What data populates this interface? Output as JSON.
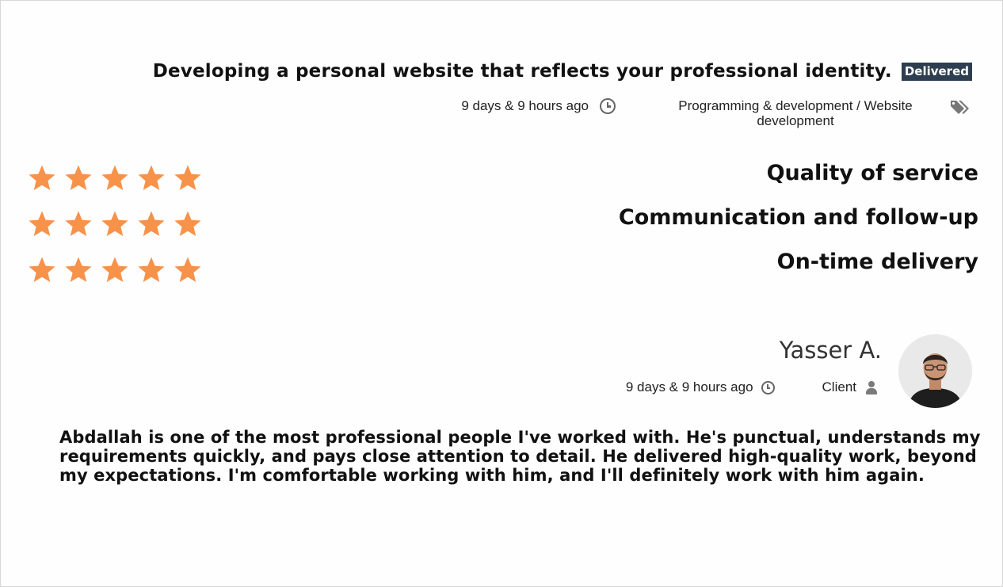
{
  "project": {
    "title": "Developing a personal website that reflects your professional identity.",
    "status": "Delivered",
    "posted_time": "9 days & 9 hours ago",
    "category": "Programming & development / Website development"
  },
  "ratings": {
    "star_color": "#f7924a",
    "items": [
      {
        "label": "Quality of service",
        "stars": 5,
        "max": 5
      },
      {
        "label": "Communication and follow-up",
        "stars": 5,
        "max": 5
      },
      {
        "label": "On-time delivery",
        "stars": 5,
        "max": 5
      }
    ]
  },
  "reviewer": {
    "name": "Yasser A.",
    "time": "9 days & 9 hours ago",
    "role": "Client"
  },
  "review": {
    "text": "Abdallah is one of the most professional people I've worked with. He's punctual, understands my requirements quickly, and pays close attention to detail. He delivered high-quality work, beyond my expectations. I'm comfortable working with him, and I'll definitely work with him again."
  },
  "icons": {
    "time": "clock-icon",
    "category": "tags-icon",
    "role": "user-icon"
  },
  "colors": {
    "badge_bg": "#2c3e50",
    "star": "#f7924a"
  }
}
